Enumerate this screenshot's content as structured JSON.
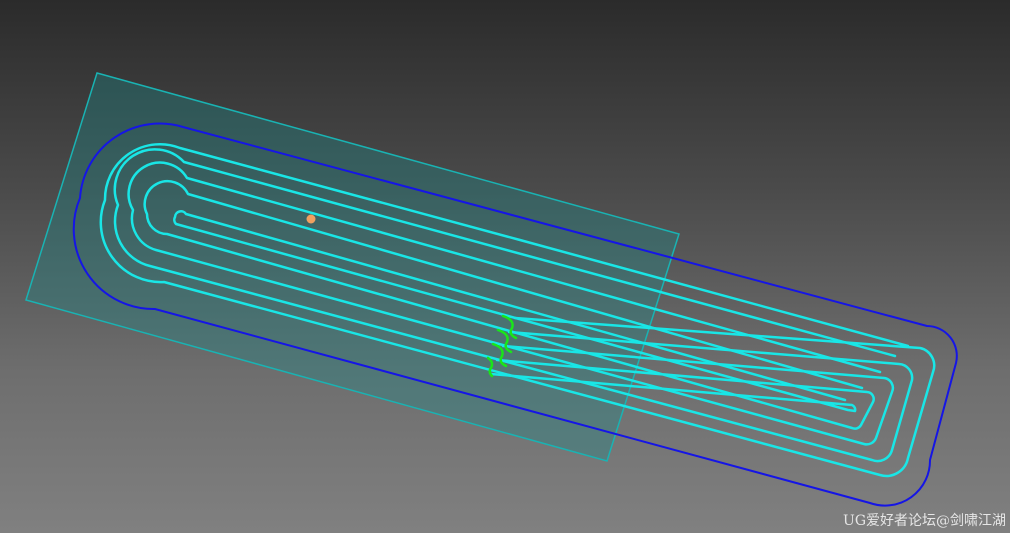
{
  "viewport": {
    "background_top": "#2b2b2b",
    "background_bottom": "#808080"
  },
  "colors": {
    "boundary": "#1515e6",
    "toolpath": "#19e6e6",
    "engage": "#19e619",
    "plane_fill": "#1a8a8a",
    "plane_edge": "#19b3b3",
    "start_point": "#f0a060"
  },
  "watermark": {
    "text": "UG爱好者论坛@剑啸江湖"
  }
}
